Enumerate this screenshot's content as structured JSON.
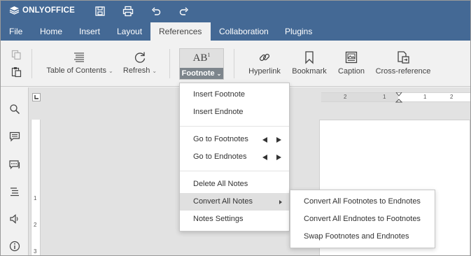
{
  "app": {
    "logo_text": "ONLYOFFICE"
  },
  "menu_tabs": [
    {
      "label": "File"
    },
    {
      "label": "Home"
    },
    {
      "label": "Insert"
    },
    {
      "label": "Layout"
    },
    {
      "label": "References"
    },
    {
      "label": "Collaboration"
    },
    {
      "label": "Plugins"
    }
  ],
  "active_tab": "References",
  "toolbar": {
    "toc_label": "Table of Contents",
    "refresh_label": "Refresh",
    "footnote_icon_text": "AB",
    "footnote_icon_sup": "1",
    "footnote_label": "Footnote",
    "hyperlink_label": "Hyperlink",
    "bookmark_label": "Bookmark",
    "caption_label": "Caption",
    "crossref_label": "Cross-reference"
  },
  "footnote_menu": {
    "items": [
      {
        "label": "Insert Footnote"
      },
      {
        "label": "Insert Endnote"
      },
      {
        "label": "Go to Footnotes"
      },
      {
        "label": "Go to Endnotes"
      },
      {
        "label": "Delete All Notes"
      },
      {
        "label": "Convert All Notes"
      },
      {
        "label": "Notes Settings"
      }
    ]
  },
  "convert_submenu": {
    "items": [
      {
        "label": "Convert All Footnotes to Endnotes"
      },
      {
        "label": "Convert All Endnotes to Footnotes"
      },
      {
        "label": "Swap Footnotes and Endnotes"
      }
    ]
  },
  "ruler": {
    "h_marks": [
      "2",
      "1",
      "1",
      "2"
    ],
    "v_marks": [
      "1",
      "2",
      "3"
    ]
  },
  "colors": {
    "header_bg": "#446995",
    "toolbar_bg": "#f1f1f1",
    "highlight": "#e0e0e0"
  }
}
